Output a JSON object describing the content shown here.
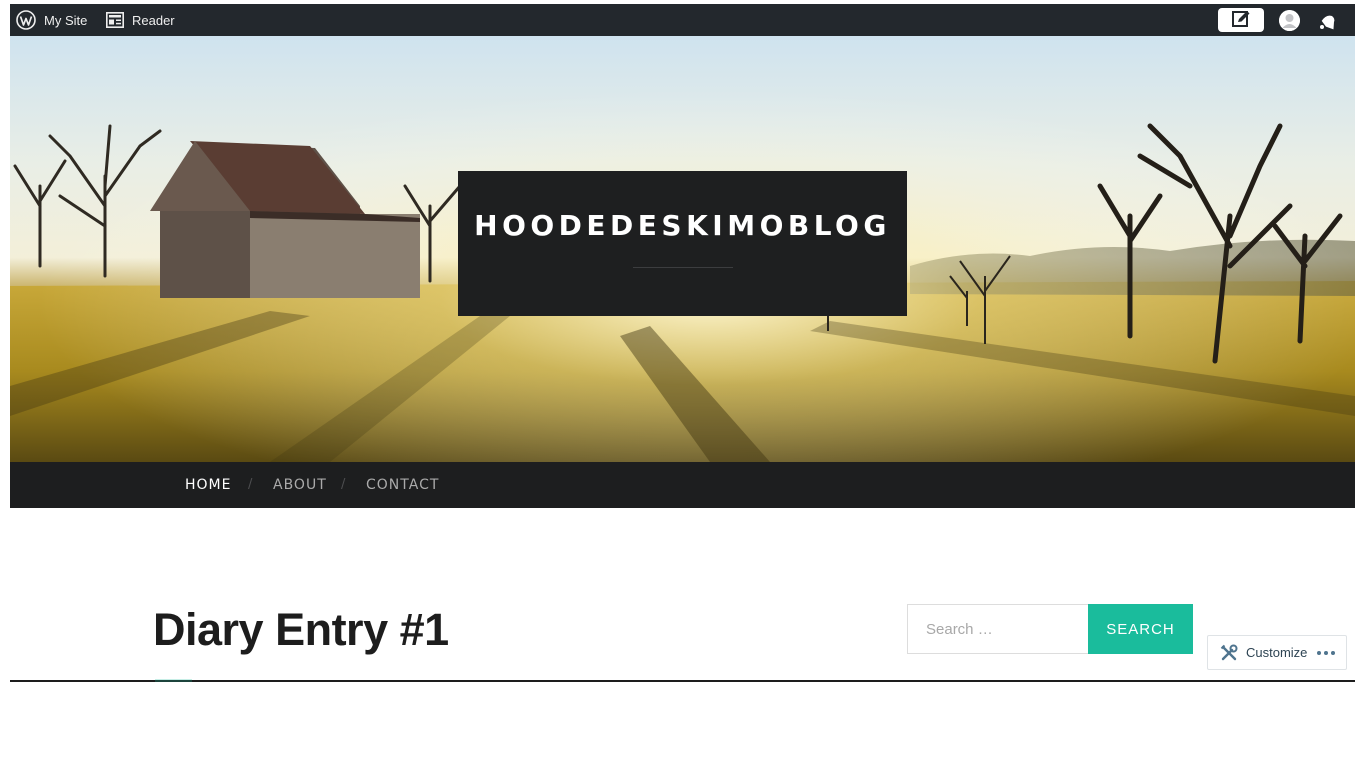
{
  "admin_bar": {
    "my_site": "My Site",
    "reader": "Reader",
    "icons": [
      "wordpress-icon",
      "reader-icon",
      "write-icon",
      "avatar-icon",
      "notifications-icon"
    ]
  },
  "site": {
    "title": "HOODEDESKIMOBLOG"
  },
  "nav": {
    "items": [
      {
        "label": "HOME",
        "active": true
      },
      {
        "label": "ABOUT",
        "active": false
      },
      {
        "label": "CONTACT",
        "active": false
      }
    ],
    "separator": "/"
  },
  "post": {
    "title": "Diary Entry #1"
  },
  "search": {
    "placeholder": "Search …",
    "button": "SEARCH"
  },
  "customize": {
    "label": "Customize"
  },
  "colors": {
    "admin_bar_bg": "#23282d",
    "nav_bg": "#1d1e1f",
    "title_box_bg": "#1e1f20",
    "accent": "#1abc9c",
    "customize_text": "#2e4453"
  }
}
